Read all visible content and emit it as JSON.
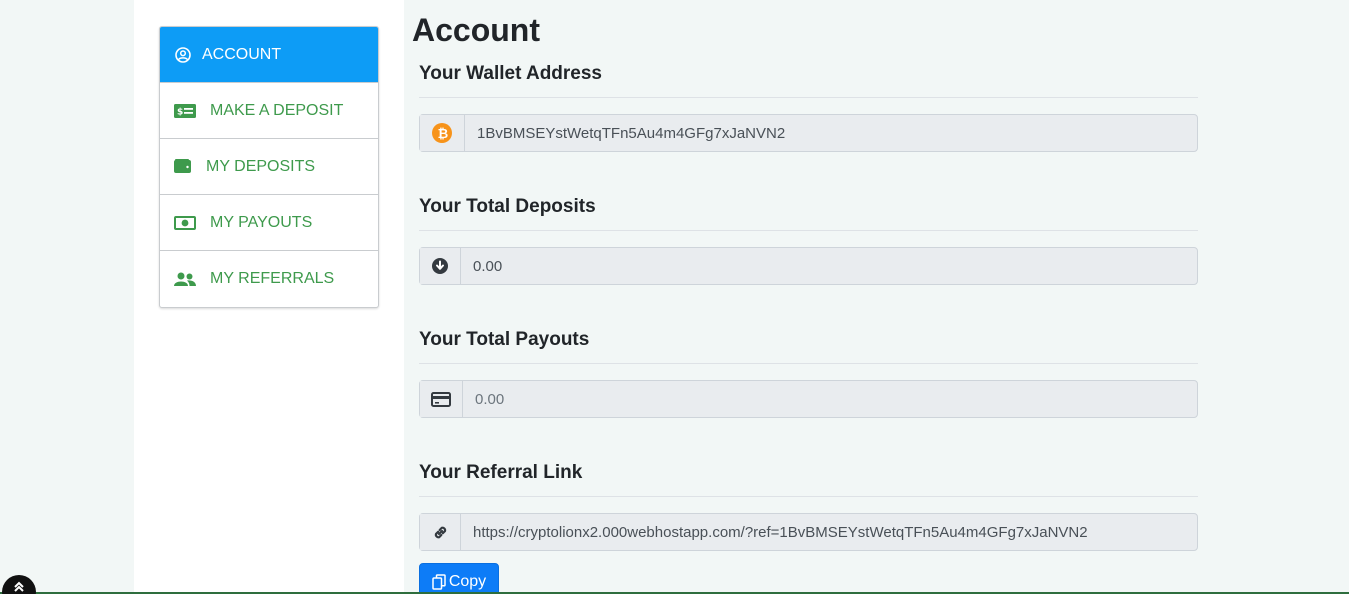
{
  "sidebar": {
    "items": [
      {
        "label": "ACCOUNT",
        "icon": "user-circle-icon"
      },
      {
        "label": "MAKE A DEPOSIT",
        "icon": "money-bill-icon"
      },
      {
        "label": "MY DEPOSITS",
        "icon": "wallet-icon"
      },
      {
        "label": "MY PAYOUTS",
        "icon": "money-note-icon"
      },
      {
        "label": "MY REFERRALS",
        "icon": "users-icon"
      }
    ]
  },
  "main": {
    "title": "Account",
    "wallet": {
      "heading": "Your Wallet Address",
      "value": "1BvBMSEYstWetqTFn5Au4m4GFg7xJaNVN2",
      "icon": "bitcoin-icon"
    },
    "deposits": {
      "heading": "Your Total Deposits",
      "value": "0.00",
      "icon": "arrow-down-circle-icon"
    },
    "payouts": {
      "heading": "Your Total Payouts",
      "value": "0.00",
      "icon": "credit-card-icon"
    },
    "referral": {
      "heading": "Your Referral Link",
      "value": "https://cryptolionx2.000webhostapp.com/?ref=1BvBMSEYstWetqTFn5Au4m4GFg7xJaNVN2",
      "icon": "link-icon"
    },
    "copy_label": "Copy"
  },
  "colors": {
    "accent": "#0d9cf6",
    "menu_text": "#3e9a4c",
    "button": "#0d7cf7",
    "bitcoin": "#f7931a"
  }
}
